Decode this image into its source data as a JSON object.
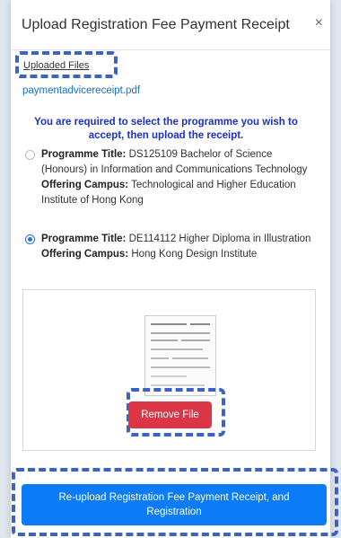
{
  "modal": {
    "title": "Upload Registration Fee Payment Receipt",
    "close_label": "×"
  },
  "files": {
    "label": "Uploaded Files",
    "filename": "paymentadvicereceipt.pdf"
  },
  "instruction": "You are required to select the programme you wish to accept, then upload the receipt.",
  "options": [
    {
      "programme_label": "Programme Title:",
      "programme_value": "DS125109 Bachelor of Science (Honours) in Information and Communications Technology",
      "campus_label": "Offering Campus:",
      "campus_value": "Technological and Higher Education Institute of Hong Kong",
      "selected": false
    },
    {
      "programme_label": "Programme Title:",
      "programme_value": "DE114112 Higher Diploma in Illustration",
      "campus_label": "Offering Campus:",
      "campus_value": "Hong Kong Design Institute",
      "selected": true
    }
  ],
  "buttons": {
    "remove_file": "Remove File",
    "reupload": "Re-upload Registration Fee Payment Receipt, and Registration"
  },
  "colors": {
    "instruction": "#1a2fd0",
    "link": "#1a6fc7",
    "remove": "#dc3545",
    "primary": "#0b7bf7",
    "highlight_dash": "#3b62c4"
  }
}
